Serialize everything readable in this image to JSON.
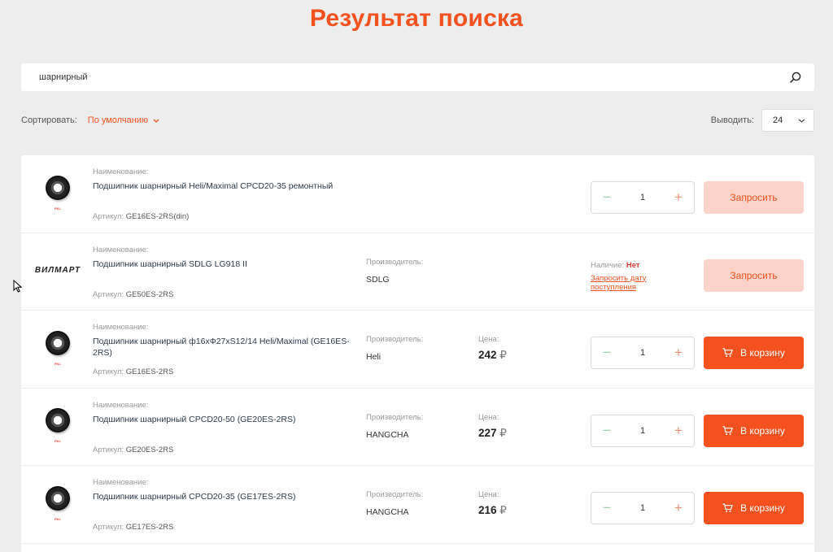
{
  "page": {
    "title": "Результат поиска"
  },
  "search": {
    "value": "шарнирный"
  },
  "sort": {
    "label": "Сортировать:",
    "selected": "По умолчанию"
  },
  "display": {
    "label": "Выводить:",
    "selected": "24"
  },
  "colors": {
    "accent": "#f4511e",
    "request_bg": "#fcd3c8",
    "page_bg": "#ededed"
  },
  "products": [
    {
      "name_label": "Наименование:",
      "name": "Подшипник шарнирный Heli/Maximal CPCD20-35 ремонтный",
      "article_label": "Артикул:",
      "article": "GE16ES-2RS(din)",
      "quantity": "1",
      "button": "Запросить",
      "image": "bearing-photo"
    },
    {
      "name_label": "Наименование:",
      "name": "Подшипник шарнирный SDLG LG918 II",
      "article_label": "Артикул:",
      "article": "GE50ES-2RS",
      "manufacturer_label": "Производитель:",
      "manufacturer": "SDLG",
      "availability_label": "Наличие:",
      "availability": "Нет",
      "availability_link": "Запросить дату поступления",
      "button": "Запросить",
      "logo": "ВИЛМАРТ"
    },
    {
      "name_label": "Наименование:",
      "name": "Подшипник шарнирный ф16хФ27хS12/14 Heli/Maximal (GE16ES-2RS)",
      "article_label": "Артикул:",
      "article": "GE16ES-2RS",
      "manufacturer_label": "Производитель:",
      "manufacturer": "Heli",
      "price_label": "Цена:",
      "price": "242",
      "currency": "₽",
      "quantity": "1",
      "button": "В корзину",
      "image": "bearing-photo"
    },
    {
      "name_label": "Наименование:",
      "name": "Подшипник шарнирный CPCD20-50 (GE20ES-2RS)",
      "article_label": "Артикул:",
      "article": "GE20ES-2RS",
      "manufacturer_label": "Производитель:",
      "manufacturer": "HANGCHA",
      "price_label": "Цена:",
      "price": "227",
      "currency": "₽",
      "quantity": "1",
      "button": "В корзину",
      "image": "bearing-photo"
    },
    {
      "name_label": "Наименование:",
      "name": "Подшипник шарнирный CPCD20-35 (GE17ES-2RS)",
      "article_label": "Артикул:",
      "article": "GE17ES-2RS",
      "manufacturer_label": "Производитель:",
      "manufacturer": "HANGCHA",
      "price_label": "Цена:",
      "price": "216",
      "currency": "₽",
      "quantity": "1",
      "button": "В корзину",
      "image": "bearing-photo"
    }
  ]
}
